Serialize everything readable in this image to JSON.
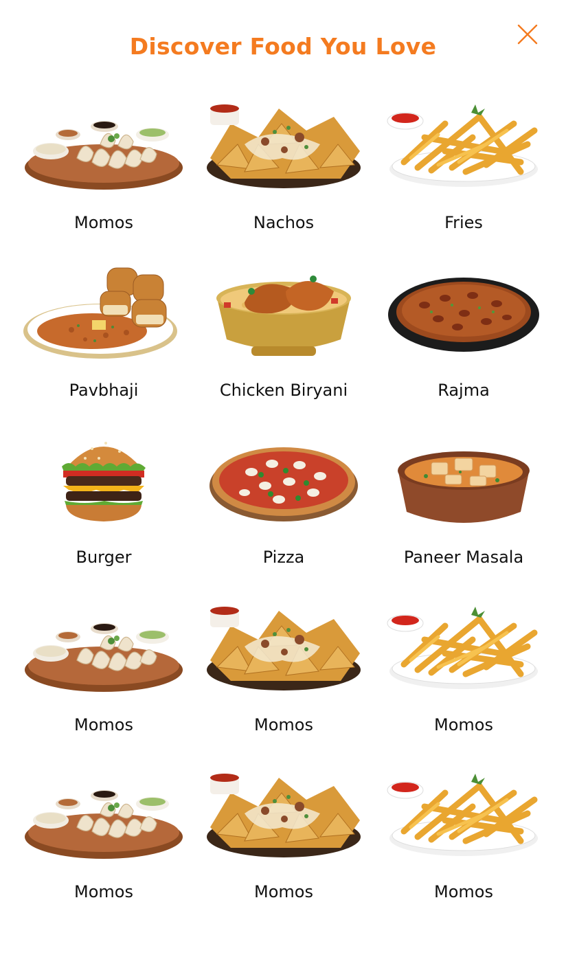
{
  "header": {
    "title": "Discover Food You Love",
    "close_icon": "close-icon",
    "accent": "#f47b20"
  },
  "items": [
    {
      "label": "Momos",
      "kind": "momos"
    },
    {
      "label": "Nachos",
      "kind": "nachos"
    },
    {
      "label": "Fries",
      "kind": "fries"
    },
    {
      "label": "Pavbhaji",
      "kind": "pavbhaji"
    },
    {
      "label": "Chicken Biryani",
      "kind": "biryani"
    },
    {
      "label": "Rajma",
      "kind": "rajma"
    },
    {
      "label": "Burger",
      "kind": "burger"
    },
    {
      "label": "Pizza",
      "kind": "pizza"
    },
    {
      "label": "Paneer Masala",
      "kind": "paneer"
    },
    {
      "label": "Momos",
      "kind": "momos"
    },
    {
      "label": "Momos",
      "kind": "nachos"
    },
    {
      "label": "Momos",
      "kind": "fries"
    },
    {
      "label": "Momos",
      "kind": "momos"
    },
    {
      "label": "Momos",
      "kind": "nachos"
    },
    {
      "label": "Momos",
      "kind": "fries"
    }
  ]
}
